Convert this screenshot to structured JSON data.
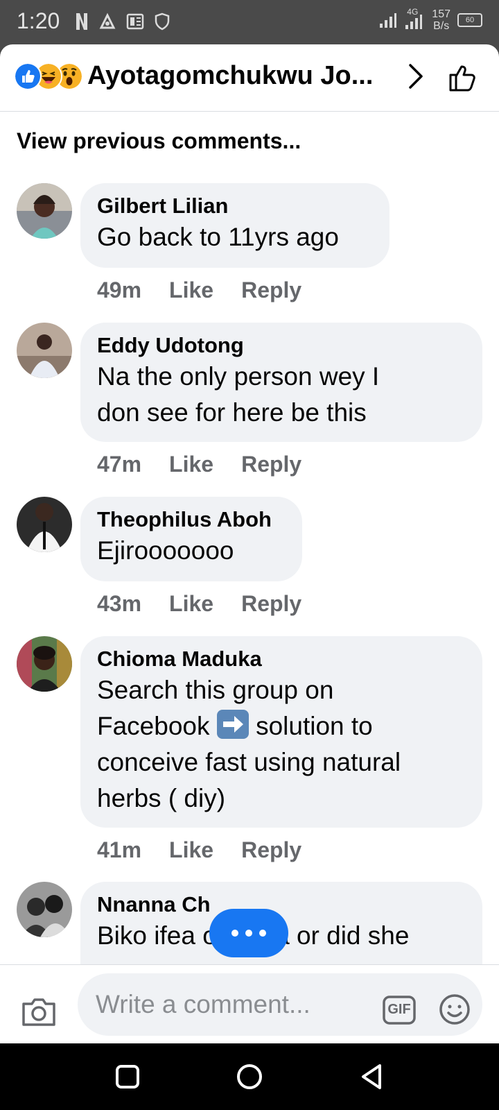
{
  "status_bar": {
    "time": "1:20",
    "network_type": "4G",
    "speed_value": "157",
    "speed_unit": "B/s",
    "battery": "60",
    "icons": [
      "netflix-icon",
      "vpn-icon",
      "news-icon",
      "shield-icon",
      "signal-icon",
      "signal-4g-icon",
      "battery-icon"
    ]
  },
  "header": {
    "title": "Ayotagomchukwu Jo...",
    "reactions": [
      "like-reaction",
      "haha-reaction",
      "wow-reaction"
    ]
  },
  "view_previous": "View previous comments...",
  "comments": [
    {
      "name": "Gilbert Lilian",
      "text": "Go back to 11yrs ago",
      "time": "49m",
      "like": "Like",
      "reply": "Reply"
    },
    {
      "name": "Eddy Udotong",
      "text_lines": [
        "Na the only person wey I",
        "don see for here be this"
      ],
      "time": "47m",
      "like": "Like",
      "reply": "Reply"
    },
    {
      "name": "Theophilus Aboh",
      "text": "Ejirooooooo",
      "time": "43m",
      "like": "Like",
      "reply": "Reply"
    },
    {
      "name": "Chioma Maduka",
      "text_lines": [
        "Search this group on",
        "Facebook",
        "solution to",
        "conceive fast using natural",
        "herbs ( diy)"
      ],
      "emoji": "➡️",
      "time": "41m",
      "like": "Like",
      "reply": "Reply"
    },
    {
      "name": "Nnanna Ch",
      "text": "Biko ifea onu ara or did she"
    }
  ],
  "composer": {
    "placeholder": "Write a comment...",
    "gif_label": "GIF"
  },
  "colors": {
    "accent": "#1877f2",
    "bubble": "#f0f2f5",
    "meta_text": "#65676b"
  }
}
